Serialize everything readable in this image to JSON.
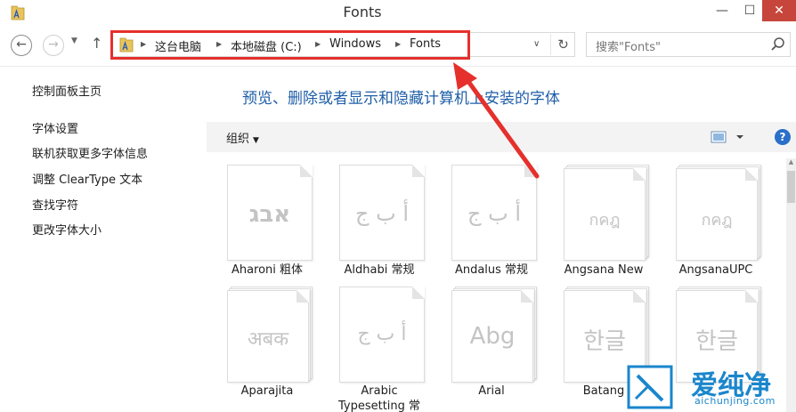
{
  "window": {
    "title": "Fonts",
    "minimize": "—",
    "maximize": "☐",
    "close": "✕"
  },
  "nav": {
    "back": "←",
    "forward": "→",
    "recent": "▼",
    "up": "↑",
    "refresh": "↻"
  },
  "breadcrumbs": [
    "这台电脑",
    "本地磁盘 (C:)",
    "Windows",
    "Fonts"
  ],
  "address_dropdown": "∨",
  "search": {
    "placeholder": "搜索\"Fonts\""
  },
  "left_pane": {
    "home": "控制面板主页",
    "links": [
      "字体设置",
      "联机获取更多字体信息",
      "调整 ClearType 文本",
      "查找字符",
      "更改字体大小"
    ]
  },
  "main": {
    "heading": "预览、删除或者显示和隐藏计算机上安装的字体",
    "organize": "组织",
    "organize_caret": "▼",
    "help": "?"
  },
  "fonts": [
    {
      "name": "Aharoni 粗体",
      "sample": "אבג",
      "stacked": false
    },
    {
      "name": "Aldhabi 常规",
      "sample": "أ ب ج",
      "stacked": false
    },
    {
      "name": "Andalus 常规",
      "sample": "أ ب ج",
      "stacked": false
    },
    {
      "name": "Angsana New",
      "sample": "กคฎ",
      "stacked": true
    },
    {
      "name": "AngsanaUPC",
      "sample": "กคฎ",
      "stacked": true
    },
    {
      "name": "Aparajita",
      "sample": "अबक",
      "stacked": true
    },
    {
      "name": "Arabic Typesetting 常",
      "sample": "أ ب ج",
      "stacked": false
    },
    {
      "name": "Arial",
      "sample": "Abg",
      "stacked": true
    },
    {
      "name": "Batang ",
      "sample": "한글",
      "stacked": true
    },
    {
      "name": "",
      "sample": "한글",
      "stacked": true
    }
  ],
  "watermark": {
    "chinese": "爱纯净",
    "url": "aichunjing.com"
  },
  "colors": {
    "accent": "#1f5ea8",
    "highlight_red": "#e5302c",
    "close_red": "#c7463c",
    "watermark_blue": "#1a86cc"
  },
  "icons": {
    "folder": "folder-icon",
    "search": "search-icon",
    "view": "view-icon",
    "help": "help-icon"
  }
}
